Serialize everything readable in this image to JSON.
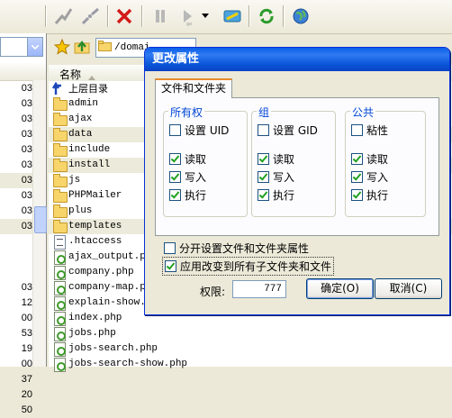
{
  "left_panel": {
    "combo_value": "",
    "rows": [
      "03",
      "03",
      "03",
      "03",
      "03",
      "03",
      "03",
      "03",
      "03",
      "03",
      "",
      "",
      "",
      "03",
      "12",
      "00",
      "53",
      "19",
      "00",
      "37",
      "20",
      "50"
    ]
  },
  "address_bar": {
    "path": "/domai"
  },
  "file_list": {
    "header_name": "名称",
    "items": [
      {
        "name": "上层目录",
        "type": "up"
      },
      {
        "name": "admin",
        "type": "folder"
      },
      {
        "name": "ajax",
        "type": "folder"
      },
      {
        "name": "data",
        "type": "folder"
      },
      {
        "name": "include",
        "type": "folder"
      },
      {
        "name": "install",
        "type": "folder"
      },
      {
        "name": "js",
        "type": "folder"
      },
      {
        "name": "PHPMailer",
        "type": "folder"
      },
      {
        "name": "plus",
        "type": "folder"
      },
      {
        "name": "templates",
        "type": "folder"
      },
      {
        "name": ".htaccess",
        "type": "file"
      },
      {
        "name": "ajax_output.php",
        "type": "php"
      },
      {
        "name": "company.php",
        "type": "php"
      },
      {
        "name": "company-map.php",
        "type": "php"
      },
      {
        "name": "explain-show.php",
        "type": "php"
      },
      {
        "name": "index.php",
        "type": "php"
      },
      {
        "name": "jobs.php",
        "type": "php"
      },
      {
        "name": "jobs-search.php",
        "type": "php"
      },
      {
        "name": "jobs-search-show.php",
        "type": "php"
      }
    ]
  },
  "dialog": {
    "title": "更改属性",
    "tab_label": "文件和文件夹",
    "owner": {
      "title": "所有权",
      "set": "设置 UID",
      "read": "读取",
      "write": "写入",
      "exec": "执行"
    },
    "group": {
      "title": "组",
      "set": "设置 GID",
      "read": "读取",
      "write": "写入",
      "exec": "执行"
    },
    "public": {
      "title": "公共",
      "set": "粘性",
      "read": "读取",
      "write": "写入",
      "exec": "执行"
    },
    "separate_option": "分开设置文件和文件夹属性",
    "recursive_option": "应用改变到所有子文件夹和文件",
    "permission_label": "权限:",
    "permission_value": "777",
    "ok_label": "确定(O)",
    "cancel_label": "取消(C)"
  }
}
